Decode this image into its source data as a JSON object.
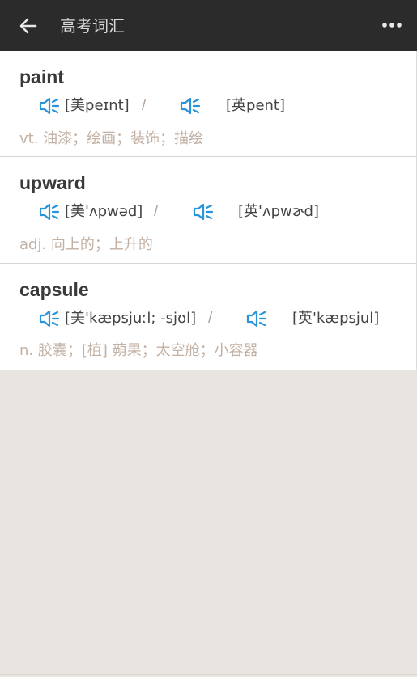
{
  "header": {
    "title": "高考词汇",
    "back_icon": "arrow-left-icon",
    "more_icon": "more-horizontal-icon"
  },
  "accent_color": "#2b93d9",
  "words": [
    {
      "word": "paint",
      "us_phonetic": "[美peɪnt]",
      "separator": "/",
      "uk_phonetic": "[英pent]",
      "meaning": "vt. 油漆；绘画；装饰；描绘"
    },
    {
      "word": "upward",
      "us_phonetic": "[美'ʌpwəd]",
      "separator": "/",
      "uk_phonetic": "[英'ʌpwɚd]",
      "meaning": "adj. 向上的；上升的"
    },
    {
      "word": "capsule",
      "us_phonetic": "[美'kæpsjuːl; -sjʊl]",
      "separator": "/",
      "uk_phonetic": "[英'kæpsjul]",
      "meaning": "n. 胶囊；[植] 蒴果；太空舱；小容器"
    }
  ]
}
